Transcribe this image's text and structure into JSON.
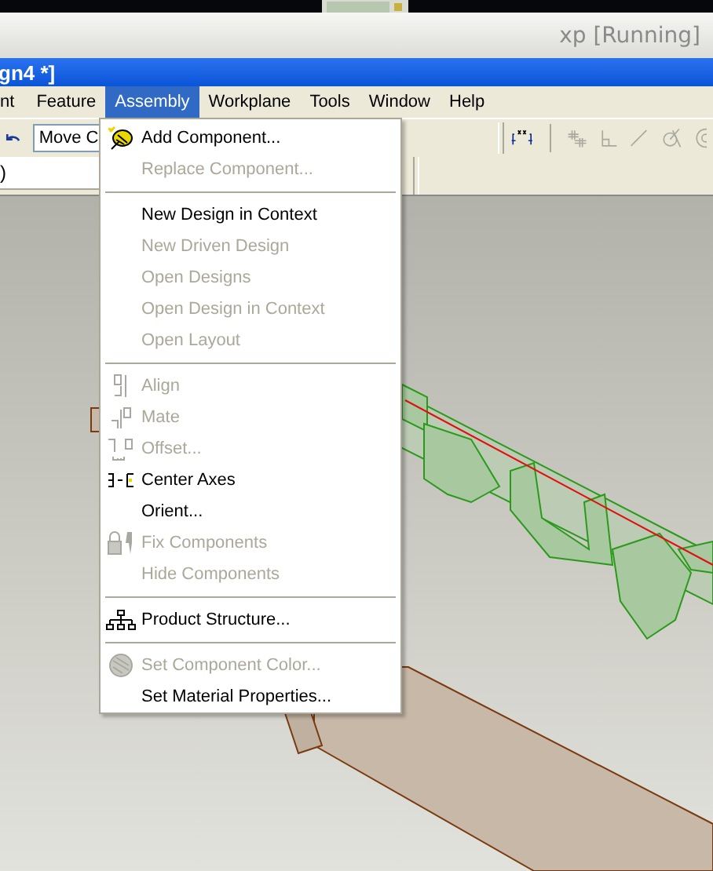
{
  "host_window": {
    "title": "xp [Running]"
  },
  "app_window": {
    "title": "gn4 *]"
  },
  "menu_bar": [
    {
      "label": "nt",
      "selected": false
    },
    {
      "label": "Feature",
      "selected": false
    },
    {
      "label": "Assembly",
      "selected": true
    },
    {
      "label": "Workplane",
      "selected": false
    },
    {
      "label": "Tools",
      "selected": false
    },
    {
      "label": "Window",
      "selected": false
    },
    {
      "label": "Help",
      "selected": false
    }
  ],
  "toolbar": {
    "combo_value": "Move C"
  },
  "field": {
    "value": ")"
  },
  "assembly_menu": [
    {
      "kind": "item",
      "label": "Add Component...",
      "disabled": false
    },
    {
      "kind": "item",
      "label": "Replace Component...",
      "disabled": true
    },
    {
      "kind": "separator"
    },
    {
      "kind": "item",
      "label": "New Design in Context",
      "disabled": false
    },
    {
      "kind": "item",
      "label": "New Driven Design",
      "disabled": true
    },
    {
      "kind": "item",
      "label": "Open Designs",
      "disabled": true
    },
    {
      "kind": "item",
      "label": "Open Design in Context",
      "disabled": true
    },
    {
      "kind": "item",
      "label": "Open Layout",
      "disabled": true
    },
    {
      "kind": "separator"
    },
    {
      "kind": "item",
      "label": "Align",
      "disabled": true
    },
    {
      "kind": "item",
      "label": "Mate",
      "disabled": true
    },
    {
      "kind": "item",
      "label": "Offset...",
      "disabled": true
    },
    {
      "kind": "item",
      "label": "Center Axes",
      "disabled": false
    },
    {
      "kind": "item",
      "label": "Orient...",
      "disabled": false
    },
    {
      "kind": "item",
      "label": "Fix Components",
      "disabled": true
    },
    {
      "kind": "item",
      "label": "Hide Components",
      "disabled": true
    },
    {
      "kind": "separator"
    },
    {
      "kind": "item",
      "label": "Product Structure...",
      "disabled": false
    },
    {
      "kind": "separator"
    },
    {
      "kind": "item",
      "label": "Set Component Color...",
      "disabled": true
    },
    {
      "kind": "item",
      "label": "Set Material Properties...",
      "disabled": false
    }
  ]
}
